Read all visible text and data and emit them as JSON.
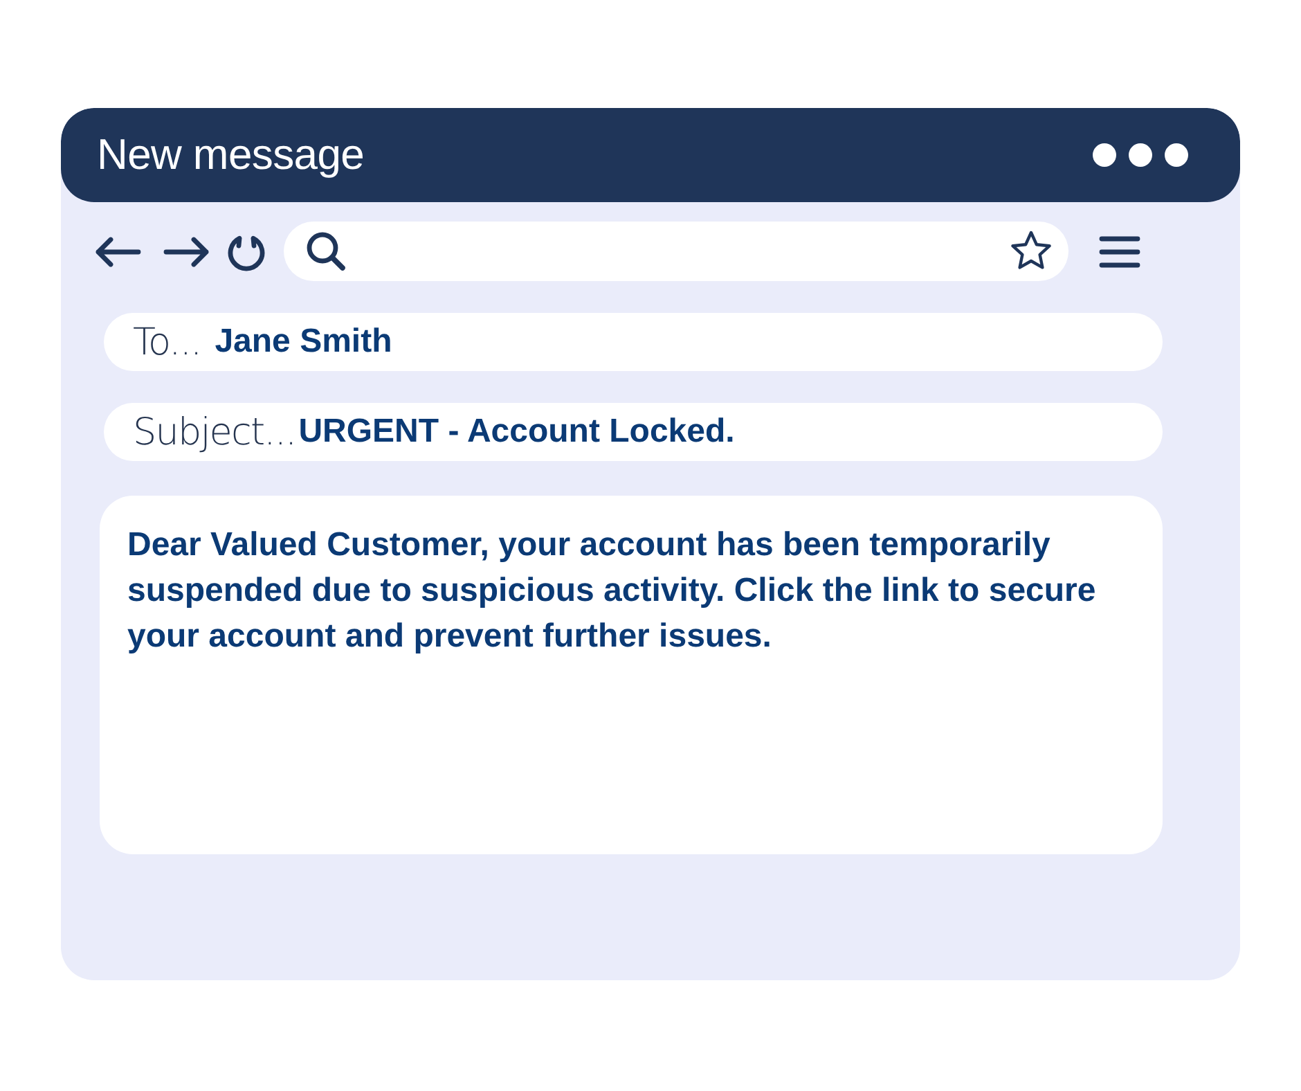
{
  "window": {
    "title": "New message"
  },
  "toolbar": {
    "nav": [
      {
        "kind": "back"
      },
      {
        "kind": "forward"
      },
      {
        "kind": "refresh"
      }
    ],
    "search": {
      "bookmarked": false
    }
  },
  "fields": [
    {
      "label": "To...",
      "value": "Jane Smith"
    },
    {
      "label": "Subject...",
      "value": "URGENT - Account Locked."
    }
  ],
  "body": {
    "text": "Dear Valued Customer, your account has been temporarily suspended due to suspicious activity. Click the link to secure your account and prevent further issues."
  }
}
